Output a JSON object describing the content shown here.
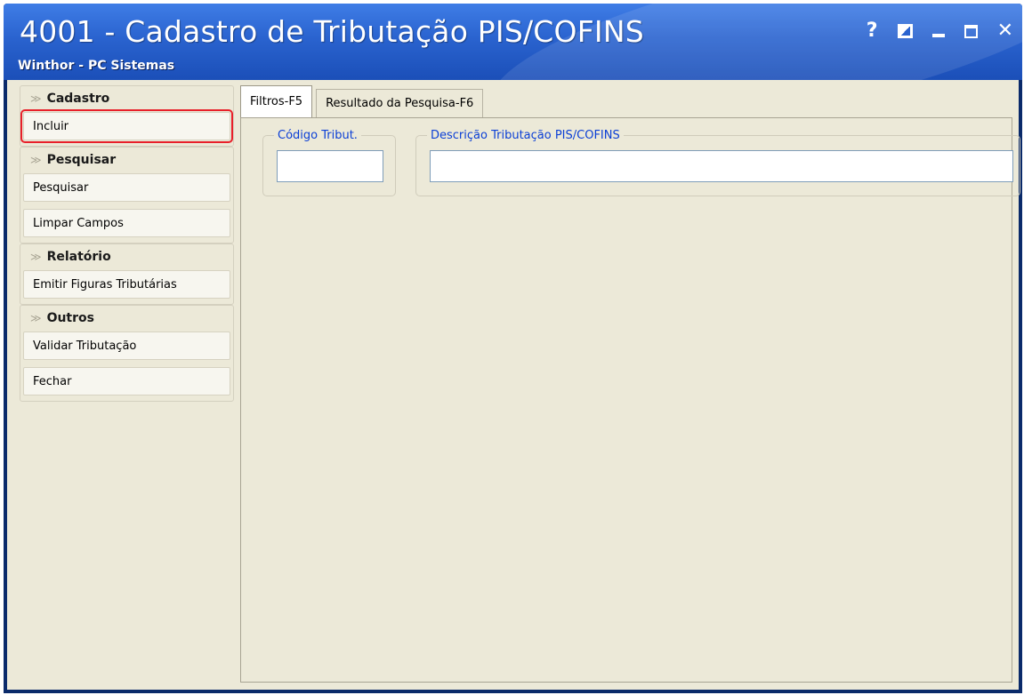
{
  "window": {
    "title": "4001 - Cadastro de Tributação PIS/COFINS",
    "subtitle": "Winthor - PC Sistemas",
    "controls": {
      "help": "?",
      "minimize": "_",
      "close": "✕"
    }
  },
  "sidebar": {
    "groups": [
      {
        "header": "Cadastro",
        "items": [
          {
            "label": "Incluir"
          }
        ]
      },
      {
        "header": "Pesquisar",
        "items": [
          {
            "label": "Pesquisar"
          },
          {
            "label": "Limpar Campos"
          }
        ]
      },
      {
        "header": "Relatório",
        "items": [
          {
            "label": "Emitir Figuras Tributárias"
          }
        ]
      },
      {
        "header": "Outros",
        "items": [
          {
            "label": "Validar Tributação"
          },
          {
            "label": "Fechar"
          }
        ]
      }
    ]
  },
  "tabs": [
    {
      "label": "Filtros-F5",
      "active": true
    },
    {
      "label": "Resultado da Pesquisa-F6",
      "active": false
    }
  ],
  "filters": {
    "codigo": {
      "label": "Código Tribut.",
      "value": ""
    },
    "descricao": {
      "label": "Descrição Tributação PIS/COFINS",
      "value": ""
    }
  },
  "colors": {
    "titlebar": "#2a63cf",
    "client_bg": "#ece9d8",
    "legend_text": "#0b3fd6",
    "highlight": "#e8202a"
  }
}
